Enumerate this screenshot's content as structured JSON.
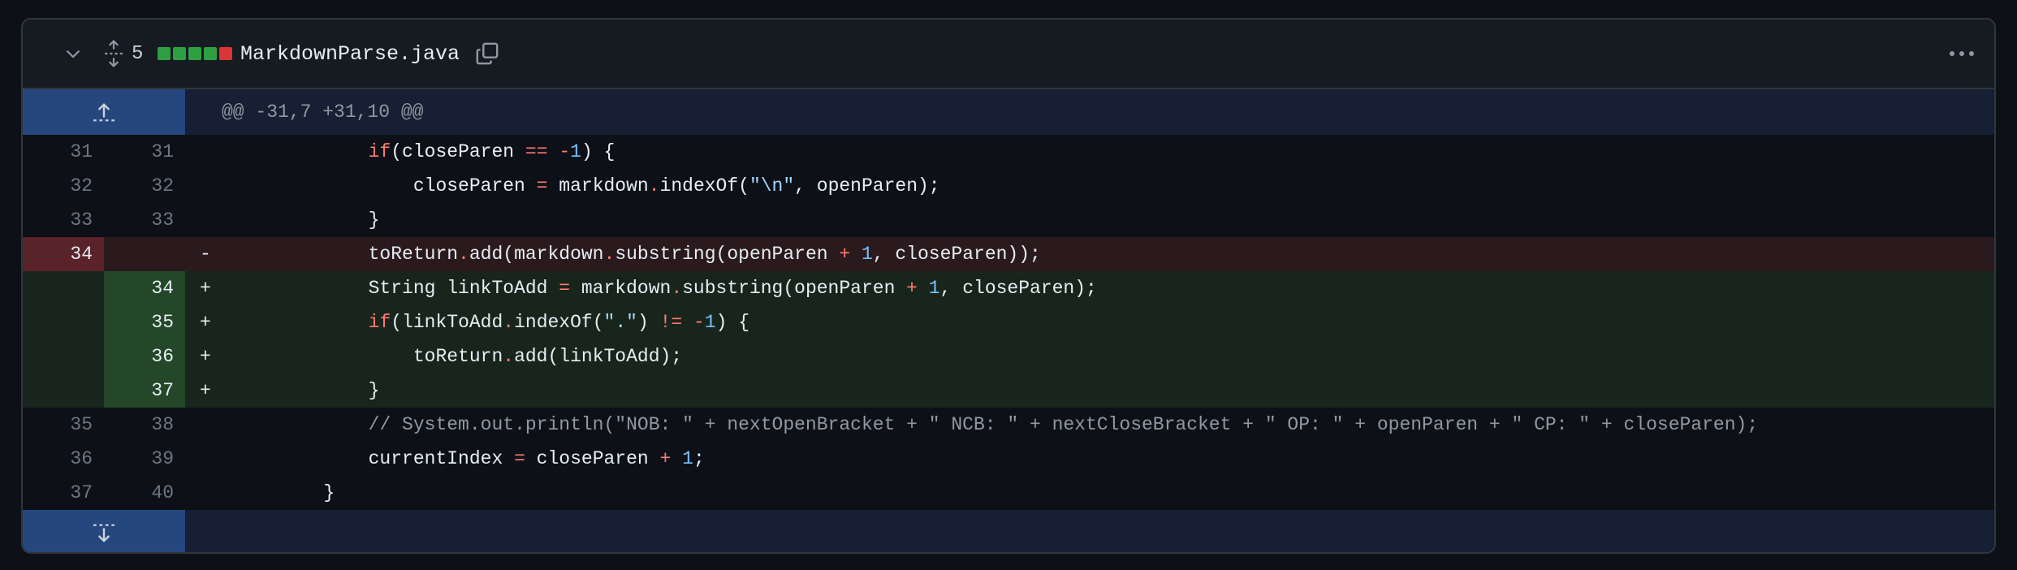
{
  "file": {
    "change_count": "5",
    "name": "MarkdownParse.java",
    "diff_squares": [
      "#2ea043",
      "#2ea043",
      "#2ea043",
      "#2ea043",
      "#da3633"
    ]
  },
  "hunk": {
    "header": "@@ -31,7 +31,10 @@"
  },
  "lines": [
    {
      "type": "ctx",
      "old": "31",
      "new": "31",
      "sign": "",
      "tokens": [
        [
          "",
          "            "
        ],
        [
          "k",
          "if"
        ],
        [
          "",
          "(closeParen "
        ],
        [
          "k",
          "=="
        ],
        [
          "",
          " "
        ],
        [
          "k",
          "-"
        ],
        [
          "n",
          "1"
        ],
        [
          "",
          ") {"
        ]
      ]
    },
    {
      "type": "ctx",
      "old": "32",
      "new": "32",
      "sign": "",
      "tokens": [
        [
          "",
          "                closeParen "
        ],
        [
          "k",
          "="
        ],
        [
          "",
          " markdown"
        ],
        [
          "k",
          "."
        ],
        [
          "",
          "indexOf("
        ],
        [
          "s",
          "\"\\n\""
        ],
        [
          "",
          ", openParen);"
        ]
      ]
    },
    {
      "type": "ctx",
      "old": "33",
      "new": "33",
      "sign": "",
      "tokens": [
        [
          "",
          "            }"
        ]
      ]
    },
    {
      "type": "del",
      "old": "34",
      "new": "",
      "sign": "-",
      "tokens": [
        [
          "",
          "            toReturn"
        ],
        [
          "k",
          "."
        ],
        [
          "",
          "add(markdown"
        ],
        [
          "k",
          "."
        ],
        [
          "",
          "substring(openParen "
        ],
        [
          "k",
          "+"
        ],
        [
          "",
          " "
        ],
        [
          "n",
          "1"
        ],
        [
          "",
          ", closeParen));"
        ]
      ]
    },
    {
      "type": "add",
      "old": "",
      "new": "34",
      "sign": "+",
      "tokens": [
        [
          "",
          "            String linkToAdd "
        ],
        [
          "k",
          "="
        ],
        [
          "",
          " markdown"
        ],
        [
          "k",
          "."
        ],
        [
          "",
          "substring(openParen "
        ],
        [
          "k",
          "+"
        ],
        [
          "",
          " "
        ],
        [
          "n",
          "1"
        ],
        [
          "",
          ", closeParen);"
        ]
      ]
    },
    {
      "type": "add",
      "old": "",
      "new": "35",
      "sign": "+",
      "tokens": [
        [
          "",
          "            "
        ],
        [
          "k",
          "if"
        ],
        [
          "",
          "(linkToAdd"
        ],
        [
          "k",
          "."
        ],
        [
          "",
          "indexOf("
        ],
        [
          "s",
          "\".\""
        ],
        [
          "",
          ") "
        ],
        [
          "k",
          "!="
        ],
        [
          "",
          " "
        ],
        [
          "k",
          "-"
        ],
        [
          "n",
          "1"
        ],
        [
          "",
          ") {"
        ]
      ]
    },
    {
      "type": "add",
      "old": "",
      "new": "36",
      "sign": "+",
      "tokens": [
        [
          "",
          "                toReturn"
        ],
        [
          "k",
          "."
        ],
        [
          "",
          "add(linkToAdd);"
        ]
      ]
    },
    {
      "type": "add",
      "old": "",
      "new": "37",
      "sign": "+",
      "tokens": [
        [
          "",
          "            }"
        ]
      ]
    },
    {
      "type": "ctx",
      "old": "35",
      "new": "38",
      "sign": "",
      "tokens": [
        [
          "",
          "            "
        ],
        [
          "c",
          "// System.out.println(\"NOB: \" + nextOpenBracket + \" NCB: \" + nextCloseBracket + \" OP: \" + openParen + \" CP: \" + closeParen);"
        ]
      ]
    },
    {
      "type": "ctx",
      "old": "36",
      "new": "39",
      "sign": "",
      "tokens": [
        [
          "",
          "            currentIndex "
        ],
        [
          "k",
          "="
        ],
        [
          "",
          " closeParen "
        ],
        [
          "k",
          "+"
        ],
        [
          "",
          " "
        ],
        [
          "n",
          "1"
        ],
        [
          "",
          ";"
        ]
      ]
    },
    {
      "type": "ctx",
      "old": "37",
      "new": "40",
      "sign": "",
      "tokens": [
        [
          "",
          "        }"
        ]
      ]
    }
  ],
  "icons": {
    "collapse": "chevron-down-icon",
    "expand_all": "unfold-icon",
    "copy": "copy-icon",
    "more": "kebab-horizontal-icon",
    "expand_up": "expand-up-icon",
    "expand_down": "expand-down-icon"
  }
}
